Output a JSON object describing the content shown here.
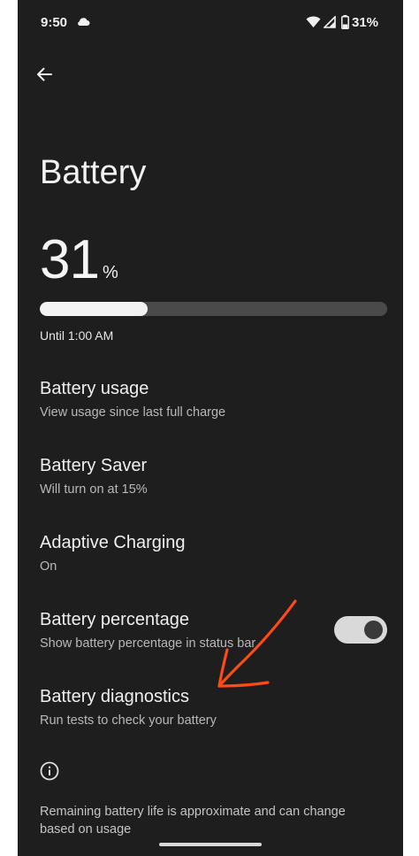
{
  "status_bar": {
    "time": "9:50",
    "battery_percent": "31%"
  },
  "header": {
    "title": "Battery"
  },
  "battery": {
    "level": "31",
    "unit": "%",
    "level_fraction": 0.31,
    "estimate": "Until 1:00 AM"
  },
  "settings": [
    {
      "title": "Battery usage",
      "subtitle": "View usage since last full charge"
    },
    {
      "title": "Battery Saver",
      "subtitle": "Will turn on at 15%"
    },
    {
      "title": "Adaptive Charging",
      "subtitle": "On"
    },
    {
      "title": "Battery percentage",
      "subtitle": "Show battery percentage in status bar",
      "toggle_on": true
    },
    {
      "title": "Battery diagnostics",
      "subtitle": "Run tests to check your battery"
    }
  ],
  "footer": {
    "note": "Remaining battery life is approximate and can change based on usage"
  },
  "colors": {
    "background": "#1e1e1e",
    "annotation": "#ff4a12"
  },
  "icons": [
    "cloud-icon",
    "wifi-icon",
    "signal-icon",
    "battery-icon",
    "back-arrow-icon",
    "info-icon"
  ]
}
